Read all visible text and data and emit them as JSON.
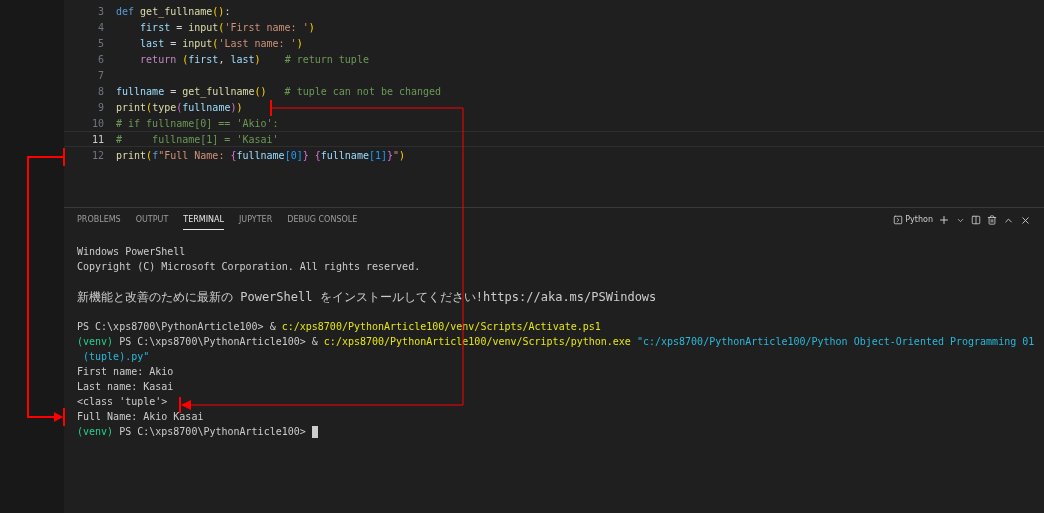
{
  "editor": {
    "lines": [
      {
        "number": "3",
        "current": false,
        "tokens": [
          {
            "kind": "keyword",
            "text": "def "
          },
          {
            "kind": "function",
            "text": "get_fullname"
          },
          {
            "kind": "paren",
            "text": "()"
          },
          {
            "kind": "plain",
            "text": ":"
          }
        ]
      },
      {
        "number": "4",
        "current": false,
        "tokens": [
          {
            "kind": "variable",
            "text": "    first"
          },
          {
            "kind": "plain",
            "text": " = "
          },
          {
            "kind": "function",
            "text": "input"
          },
          {
            "kind": "paren",
            "text": "("
          },
          {
            "kind": "string",
            "text": "'First name: '"
          },
          {
            "kind": "paren",
            "text": ")"
          }
        ]
      },
      {
        "number": "5",
        "current": false,
        "tokens": [
          {
            "kind": "variable",
            "text": "    last"
          },
          {
            "kind": "plain",
            "text": " = "
          },
          {
            "kind": "function",
            "text": "input"
          },
          {
            "kind": "paren",
            "text": "("
          },
          {
            "kind": "string",
            "text": "'Last name: '"
          },
          {
            "kind": "paren",
            "text": ")"
          }
        ]
      },
      {
        "number": "6",
        "current": false,
        "tokens": [
          {
            "kind": "control",
            "text": "    return "
          },
          {
            "kind": "paren",
            "text": "("
          },
          {
            "kind": "variable",
            "text": "first"
          },
          {
            "kind": "plain",
            "text": ", "
          },
          {
            "kind": "variable",
            "text": "last"
          },
          {
            "kind": "paren",
            "text": ")"
          },
          {
            "kind": "comment",
            "text": "    # return tuple"
          }
        ]
      },
      {
        "number": "7",
        "current": false
      },
      {
        "number": "8",
        "current": false,
        "tokens": [
          {
            "kind": "variable",
            "text": "fullname"
          },
          {
            "kind": "plain",
            "text": " = "
          },
          {
            "kind": "function",
            "text": "get_fullname"
          },
          {
            "kind": "paren",
            "text": "()"
          },
          {
            "kind": "comment",
            "text": "   # tuple can not be changed"
          }
        ]
      },
      {
        "number": "9",
        "current": false,
        "tokens": [
          {
            "kind": "function",
            "text": "print"
          },
          {
            "kind": "paren",
            "text": "("
          },
          {
            "kind": "function",
            "text": "type"
          },
          {
            "kind": "brace",
            "text": "("
          },
          {
            "kind": "variable",
            "text": "fullname"
          },
          {
            "kind": "brace",
            "text": ")"
          },
          {
            "kind": "paren",
            "text": ")"
          }
        ]
      },
      {
        "number": "10",
        "current": false,
        "tokens": [
          {
            "kind": "comment",
            "text": "# if fullname[0] == 'Akio':"
          }
        ]
      },
      {
        "number": "11",
        "current": true,
        "tokens": [
          {
            "kind": "comment",
            "text": "#     fullname[1] = 'Kasai'"
          }
        ]
      },
      {
        "number": "12",
        "current": false,
        "tokens": [
          {
            "kind": "function",
            "text": "print"
          },
          {
            "kind": "paren",
            "text": "("
          },
          {
            "kind": "keyword",
            "text": "f"
          },
          {
            "kind": "string",
            "text": "\"Full Name: "
          },
          {
            "kind": "brace",
            "text": "{"
          },
          {
            "kind": "variable",
            "text": "fullname"
          },
          {
            "kind": "bracket",
            "text": "[0]"
          },
          {
            "kind": "brace",
            "text": "}"
          },
          {
            "kind": "brace",
            "text": " {"
          },
          {
            "kind": "variable",
            "text": "fullname"
          },
          {
            "kind": "bracket",
            "text": "[1]"
          },
          {
            "kind": "brace",
            "text": "}"
          },
          {
            "kind": "string",
            "text": "\""
          },
          {
            "kind": "paren",
            "text": ")"
          }
        ]
      }
    ]
  },
  "panel": {
    "tabs": [
      {
        "label": "PROBLEMS",
        "selected": false
      },
      {
        "label": "OUTPUT",
        "selected": false
      },
      {
        "label": "TERMINAL",
        "selected": true
      },
      {
        "label": "JUPYTER",
        "selected": false
      },
      {
        "label": "DEBUG CONSOLE",
        "selected": false
      }
    ],
    "terminal_profile": "Python"
  },
  "terminal": {
    "lines": [
      {
        "space_before": false,
        "segments": [
          {
            "kind": "plain",
            "text": "Windows PowerShell"
          }
        ]
      },
      {
        "space_before": false,
        "segments": [
          {
            "kind": "plain",
            "text": "Copyright (C) Microsoft Corporation. All rights reserved."
          }
        ]
      },
      {
        "space_before": true,
        "segments": [
          {
            "kind": "notice",
            "text": "新機能と改善のために最新の PowerShell をインストールしてください!https://aka.ms/PSWindows"
          }
        ]
      },
      {
        "space_before": true,
        "segments": [
          {
            "kind": "plain",
            "text": "PS C:\\xps8700\\PythonArticle100> & "
          },
          {
            "kind": "command",
            "text": "c:/xps8700/PythonArticle100/venv/Scripts/Activate.ps1"
          }
        ]
      },
      {
        "space_before": false,
        "segments": [
          {
            "kind": "venv",
            "text": "(venv)"
          },
          {
            "kind": "plain",
            "text": " PS C:\\xps8700\\PythonArticle100> & "
          },
          {
            "kind": "command",
            "text": "c:/xps8700/PythonArticle100/venv/Scripts/python.exe"
          },
          {
            "kind": "string",
            "text": " \"c:/xps8700/PythonArticle100/Python Object-Oriented Programming 01"
          }
        ]
      },
      {
        "space_before": false,
        "segments": [
          {
            "kind": "string",
            "text": " (tuple).py\""
          }
        ]
      },
      {
        "space_before": false,
        "segments": [
          {
            "kind": "plain",
            "text": "First name: Akio"
          }
        ]
      },
      {
        "space_before": false,
        "segments": [
          {
            "kind": "plain",
            "text": "Last name: Kasai"
          }
        ]
      },
      {
        "space_before": false,
        "segments": [
          {
            "kind": "plain",
            "text": "<class 'tuple'>"
          }
        ]
      },
      {
        "space_before": false,
        "segments": [
          {
            "kind": "plain",
            "text": "Full Name: Akio Kasai"
          }
        ]
      },
      {
        "space_before": false,
        "segments": [
          {
            "kind": "venv",
            "text": "(venv)"
          },
          {
            "kind": "plain",
            "text": " PS C:\\xps8700\\PythonArticle100> "
          }
        ]
      }
    ],
    "cursor": true
  }
}
